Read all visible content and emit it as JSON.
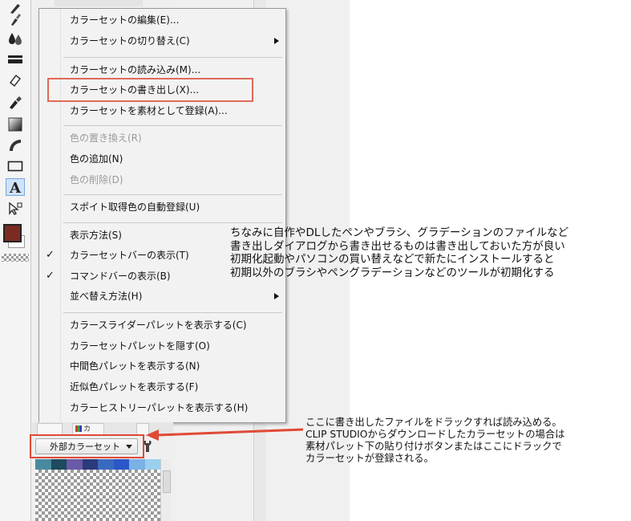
{
  "menu": {
    "items": [
      {
        "label": "カラーセットの編集(E)...",
        "disabled": false,
        "check": "",
        "submenu": false
      },
      {
        "label": "カラーセットの切り替え(C)",
        "disabled": false,
        "check": "",
        "submenu": true
      },
      {
        "label": "カラーセットの読み込み(M)...",
        "disabled": false,
        "check": "",
        "submenu": false
      },
      {
        "label": "カラーセットの書き出し(X)...",
        "disabled": false,
        "check": "",
        "submenu": false
      },
      {
        "label": "カラーセットを素材として登録(A)...",
        "disabled": false,
        "check": "",
        "submenu": false
      },
      {
        "label": "色の置き換え(R)",
        "disabled": true,
        "check": "",
        "submenu": false
      },
      {
        "label": "色の追加(N)",
        "disabled": false,
        "check": "",
        "submenu": false
      },
      {
        "label": "色の削除(D)",
        "disabled": true,
        "check": "",
        "submenu": false
      },
      {
        "label": "スポイト取得色の自動登録(U)",
        "disabled": false,
        "check": "",
        "submenu": false
      },
      {
        "label": "表示方法(S)",
        "disabled": false,
        "check": "",
        "submenu": false
      },
      {
        "label": "カラーセットバーの表示(T)",
        "disabled": false,
        "check": "✓",
        "submenu": false
      },
      {
        "label": "コマンドバーの表示(B)",
        "disabled": false,
        "check": "✓",
        "submenu": false
      },
      {
        "label": "並べ替え方法(H)",
        "disabled": false,
        "check": "",
        "submenu": true
      },
      {
        "label": "カラースライダーパレットを表示する(C)",
        "disabled": false,
        "check": "",
        "submenu": false
      },
      {
        "label": "カラーセットパレットを隠す(O)",
        "disabled": false,
        "check": "",
        "submenu": false
      },
      {
        "label": "中間色パレットを表示する(N)",
        "disabled": false,
        "check": "",
        "submenu": false
      },
      {
        "label": "近似色パレットを表示する(F)",
        "disabled": false,
        "check": "",
        "submenu": false
      },
      {
        "label": "カラーヒストリーパレットを表示する(H)",
        "disabled": false,
        "check": "",
        "submenu": false
      }
    ]
  },
  "palette": {
    "tab_label": "カ",
    "colorset_name": "外部カラーセット",
    "swatch_colors": [
      "#4a8aa0",
      "#1e4a5e",
      "#6a5aa8",
      "#2a3a7a",
      "#3a6ac0",
      "#2a58c8",
      "#7ab2e6",
      "#9ad0ee"
    ]
  },
  "notes": {
    "note1_lines": [
      "ちなみに自作やDLしたペンやブラシ、グラデーションのファイルなど",
      "書き出しダイアログから書き出せるものは書き出しておいた方が良い",
      "初期化起動やパソコンの買い替えなどで新たにインストールすると",
      "初期以外のブラシやペングラデーションなどのツールが初期化する"
    ],
    "note2_lines": [
      "ここに書き出したファイルをドラックすれば読み込める。",
      "CLIP STUDIOからダウンロードしたカラーセットの場合は",
      "素材パレット下の貼り付けボタンまたはここにドラックで",
      "カラーセットが登録される。"
    ]
  },
  "colors": {
    "highlight_box": "#e06a58",
    "annotation_red": "#e04a36",
    "main_color": "#7b2b22"
  },
  "icons": [
    "pen-icon",
    "ink-drop-icon",
    "fill-icon",
    "eraser-icon",
    "decoration-brush-icon",
    "gradient-icon",
    "figure-ruler-icon",
    "rectangle-icon",
    "text-tool-icon",
    "object-select-icon",
    "wrench-icon"
  ]
}
